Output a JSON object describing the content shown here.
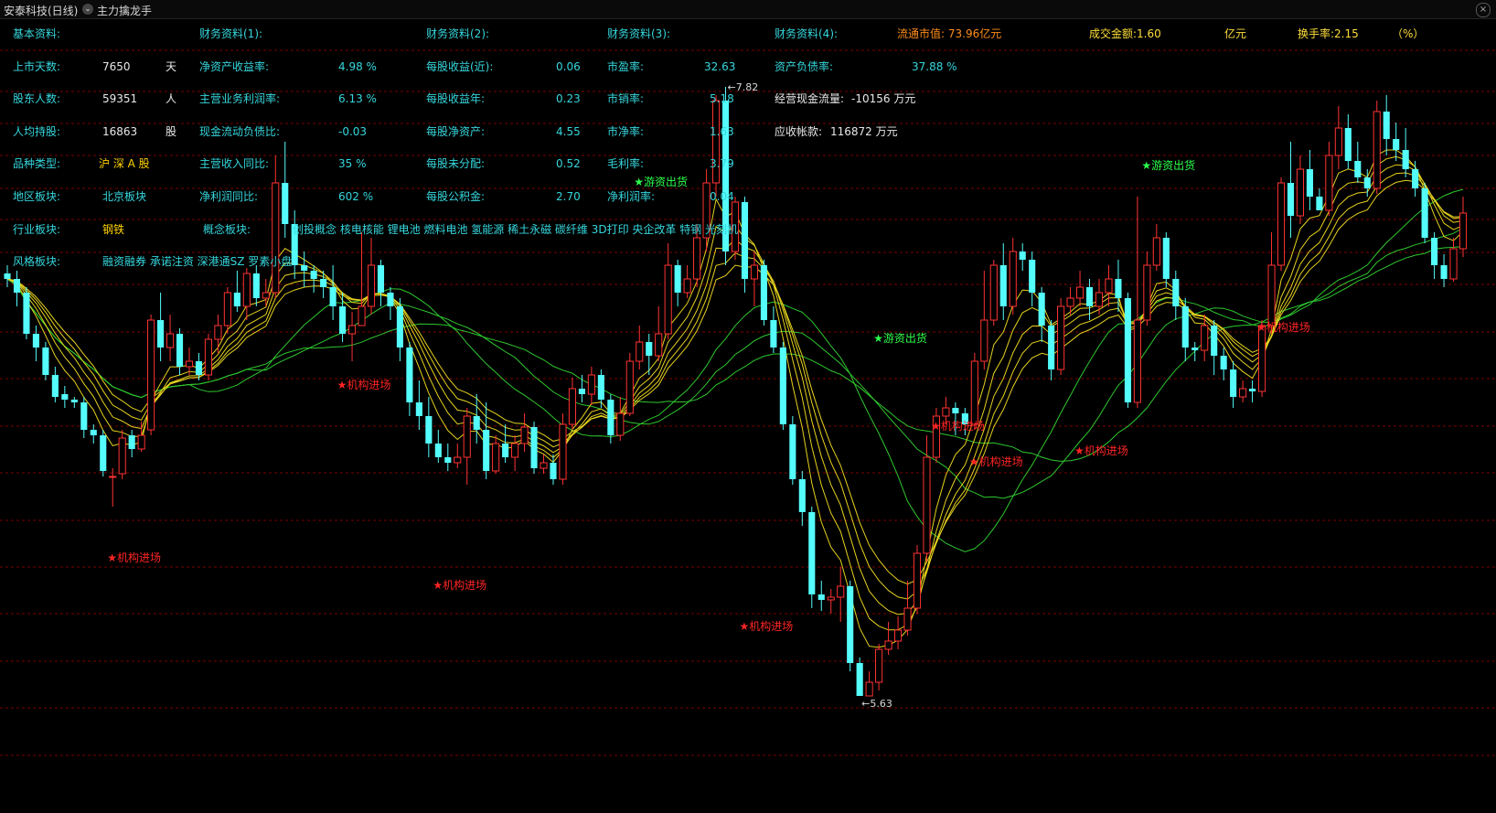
{
  "window": {
    "title": "安泰科技(日线)",
    "indicator_name": "主力擒龙手",
    "close_symbol": "×"
  },
  "info_panel": {
    "col1": {
      "header": "基本资料:",
      "rows": [
        {
          "label": "上市天数:",
          "value": "7650",
          "unit": "天"
        },
        {
          "label": "股东人数:",
          "value": "59351",
          "unit": "人"
        },
        {
          "label": "人均持股:",
          "value": "16863",
          "unit": "股"
        },
        {
          "label": "品种类型:",
          "value": "沪 深 A 股",
          "unit": ""
        },
        {
          "label": "地区板块:",
          "value": "北京板块",
          "unit": ""
        },
        {
          "label": "行业板块:",
          "value": "钢铁",
          "unit": ""
        },
        {
          "label": "风格板块:",
          "value": "融资融券 承诺注资 深港通SZ 罗素小盘",
          "unit": ""
        }
      ]
    },
    "col2": {
      "header": "财务资料(1):",
      "rows": [
        {
          "label": "净资产收益率:",
          "value": "4.98 %"
        },
        {
          "label": "主营业务利润率:",
          "value": "6.13 %"
        },
        {
          "label": "现金流动负债比:",
          "value": "-0.03"
        },
        {
          "label": "主营收入同比:",
          "value": "35 %"
        },
        {
          "label": "净利润同比:",
          "value": "602 %"
        }
      ],
      "concept_label": "概念板块:",
      "concept_value": "创投概念 核电核能 锂电池 燃料电池 氢能源 稀土永磁 碳纤维 3D打印 央企改革 特钢 光刻机"
    },
    "col3": {
      "header": "财务资料(2):",
      "rows": [
        {
          "label": "每股收益(近):",
          "value": "0.06"
        },
        {
          "label": "每股收益年:",
          "value": "0.23"
        },
        {
          "label": "每股净资产:",
          "value": "4.55"
        },
        {
          "label": "每股未分配:",
          "value": "0.52"
        },
        {
          "label": "每股公积金:",
          "value": "2.70"
        }
      ]
    },
    "col4": {
      "header": "财务资料(3):",
      "rows": [
        {
          "label": "市盈率:",
          "value": "32.63"
        },
        {
          "label": "市销率:",
          "value": "5.18"
        },
        {
          "label": "市净率:",
          "value": "1.63"
        },
        {
          "label": "毛利率:",
          "value": "3.79"
        },
        {
          "label": "净利润率:",
          "value": "0.04"
        }
      ]
    },
    "col5": {
      "header": "财务资料(4):",
      "rows": [
        {
          "label": "资产负债率:",
          "value": "37.88 %"
        },
        {
          "label": "经营现金流量:",
          "value": "-10156 万元"
        },
        {
          "label": "应收帐款:",
          "value": "116872 万元"
        }
      ]
    },
    "market": {
      "float_cap": "流通市值: 73.96亿元",
      "turnover_amount": "成交金额:1.60",
      "turnover_unit": "亿元",
      "turnover_rate": "换手率:2.15",
      "turnover_rate_unit": "（%）"
    }
  },
  "chart_data": {
    "type": "candlestick",
    "y_range": [
      5.3,
      8.05
    ],
    "high_label": "7.82",
    "low_label": "5.63",
    "colors": {
      "up": "#ff3232",
      "down": "#54fcfc",
      "ma_yellow": "#e6d21e",
      "ma_green": "#2ec82e",
      "grid": "#7a0000"
    },
    "candles": [
      [
        7.17,
        7.15,
        7.2,
        7.12
      ],
      [
        7.15,
        7.1,
        7.18,
        7.05
      ],
      [
        7.1,
        6.95,
        7.12,
        6.93
      ],
      [
        6.95,
        6.9,
        6.98,
        6.85
      ],
      [
        6.9,
        6.8,
        6.92,
        6.78
      ],
      [
        6.8,
        6.72,
        6.83,
        6.7
      ],
      [
        6.73,
        6.71,
        6.76,
        6.68
      ],
      [
        6.71,
        6.7,
        6.72,
        6.68
      ],
      [
        6.7,
        6.6,
        6.72,
        6.57
      ],
      [
        6.6,
        6.58,
        6.62,
        6.55
      ],
      [
        6.58,
        6.45,
        6.6,
        6.43
      ],
      [
        6.43,
        6.43,
        6.46,
        6.32
      ],
      [
        6.44,
        6.57,
        6.6,
        6.42
      ],
      [
        6.58,
        6.53,
        6.6,
        6.5
      ],
      [
        6.53,
        6.58,
        6.63,
        6.52
      ],
      [
        6.6,
        7.0,
        7.02,
        6.58
      ],
      [
        7.0,
        6.9,
        7.1,
        6.85
      ],
      [
        6.9,
        6.95,
        7.02,
        6.85
      ],
      [
        6.95,
        6.83,
        6.97,
        6.8
      ],
      [
        6.83,
        6.85,
        6.9,
        6.8
      ],
      [
        6.85,
        6.8,
        6.88,
        6.78
      ],
      [
        6.8,
        6.93,
        6.95,
        6.78
      ],
      [
        6.93,
        6.98,
        7.02,
        6.88
      ],
      [
        6.98,
        7.1,
        7.12,
        6.95
      ],
      [
        7.1,
        7.05,
        7.18,
        7.03
      ],
      [
        7.05,
        7.17,
        7.19,
        7.0
      ],
      [
        7.17,
        7.08,
        7.2,
        7.05
      ],
      [
        7.08,
        7.1,
        7.15,
        7.05
      ],
      [
        7.1,
        7.5,
        7.6,
        7.08
      ],
      [
        7.5,
        7.35,
        7.65,
        7.3
      ],
      [
        7.35,
        7.2,
        7.4,
        7.15
      ],
      [
        7.2,
        7.18,
        7.25,
        7.12
      ],
      [
        7.18,
        7.15,
        7.2,
        7.1
      ],
      [
        7.15,
        7.12,
        7.18,
        7.08
      ],
      [
        7.12,
        7.05,
        7.2,
        7.0
      ],
      [
        7.05,
        6.95,
        7.1,
        6.92
      ],
      [
        6.95,
        6.98,
        7.03,
        6.85
      ],
      [
        6.98,
        7.05,
        7.32,
        6.98
      ],
      [
        7.05,
        7.2,
        7.3,
        7.02
      ],
      [
        7.2,
        7.1,
        7.22,
        7.05
      ],
      [
        7.1,
        7.05,
        7.12,
        7.0
      ],
      [
        7.05,
        6.9,
        7.08,
        6.85
      ],
      [
        6.9,
        6.7,
        6.92,
        6.65
      ],
      [
        6.7,
        6.65,
        6.78,
        6.6
      ],
      [
        6.65,
        6.55,
        6.72,
        6.5
      ],
      [
        6.55,
        6.5,
        6.6,
        6.48
      ],
      [
        6.5,
        6.48,
        6.55,
        6.45
      ],
      [
        6.48,
        6.5,
        6.55,
        6.46
      ],
      [
        6.5,
        6.65,
        6.68,
        6.4
      ],
      [
        6.65,
        6.6,
        6.73,
        6.55
      ],
      [
        6.6,
        6.45,
        6.7,
        6.42
      ],
      [
        6.45,
        6.55,
        6.58,
        6.44
      ],
      [
        6.55,
        6.5,
        6.62,
        6.48
      ],
      [
        6.5,
        6.55,
        6.58,
        6.45
      ],
      [
        6.55,
        6.61,
        6.66,
        6.52
      ],
      [
        6.61,
        6.46,
        6.63,
        6.44
      ],
      [
        6.46,
        6.48,
        6.51,
        6.44
      ],
      [
        6.48,
        6.42,
        6.51,
        6.4
      ],
      [
        6.42,
        6.62,
        6.66,
        6.4
      ],
      [
        6.62,
        6.75,
        6.79,
        6.6
      ],
      [
        6.75,
        6.73,
        6.8,
        6.7
      ],
      [
        6.73,
        6.8,
        6.83,
        6.69
      ],
      [
        6.8,
        6.71,
        6.82,
        6.68
      ],
      [
        6.71,
        6.58,
        6.73,
        6.55
      ],
      [
        6.58,
        6.66,
        6.72,
        6.56
      ],
      [
        6.66,
        6.85,
        6.88,
        6.65
      ],
      [
        6.85,
        6.92,
        6.98,
        6.82
      ],
      [
        6.92,
        6.87,
        6.95,
        6.8
      ],
      [
        6.87,
        6.95,
        7.05,
        6.85
      ],
      [
        6.95,
        7.2,
        7.28,
        6.93
      ],
      [
        7.2,
        7.1,
        7.22,
        7.05
      ],
      [
        7.1,
        7.15,
        7.2,
        7.08
      ],
      [
        7.15,
        7.3,
        7.35,
        7.12
      ],
      [
        7.3,
        7.5,
        7.55,
        7.25
      ],
      [
        7.5,
        7.8,
        7.82,
        7.45
      ],
      [
        7.8,
        7.25,
        7.85,
        7.2
      ],
      [
        7.25,
        7.43,
        7.45,
        7.22
      ],
      [
        7.43,
        7.15,
        7.45,
        7.1
      ],
      [
        7.15,
        7.2,
        7.25,
        7.05
      ],
      [
        7.2,
        7.0,
        7.22,
        6.98
      ],
      [
        7.0,
        6.9,
        7.05,
        6.88
      ],
      [
        6.9,
        6.62,
        6.92,
        6.6
      ],
      [
        6.62,
        6.42,
        6.65,
        6.4
      ],
      [
        6.42,
        6.3,
        6.45,
        6.25
      ],
      [
        6.3,
        6.0,
        6.32,
        5.95
      ],
      [
        6.0,
        5.98,
        6.05,
        5.94
      ],
      [
        5.98,
        5.99,
        6.02,
        5.93
      ],
      [
        5.99,
        6.03,
        6.1,
        5.9
      ],
      [
        6.03,
        5.75,
        6.05,
        5.72
      ],
      [
        5.75,
        5.63,
        5.77,
        5.63
      ],
      [
        5.63,
        5.68,
        5.72,
        5.63
      ],
      [
        5.68,
        5.8,
        5.82,
        5.65
      ],
      [
        5.8,
        5.83,
        5.9,
        5.78
      ],
      [
        5.83,
        5.87,
        5.92,
        5.8
      ],
      [
        5.87,
        5.95,
        6.05,
        5.85
      ],
      [
        5.95,
        6.15,
        6.18,
        5.93
      ],
      [
        6.15,
        6.5,
        6.58,
        6.12
      ],
      [
        6.5,
        6.65,
        6.68,
        6.48
      ],
      [
        6.65,
        6.68,
        6.72,
        6.62
      ],
      [
        6.68,
        6.66,
        6.7,
        6.58
      ],
      [
        6.66,
        6.62,
        6.68,
        6.58
      ],
      [
        6.62,
        6.85,
        6.88,
        6.6
      ],
      [
        6.85,
        7.0,
        7.18,
        6.82
      ],
      [
        7.0,
        7.2,
        7.22,
        6.98
      ],
      [
        7.2,
        7.05,
        7.28,
        7.0
      ],
      [
        7.05,
        7.25,
        7.3,
        7.02
      ],
      [
        7.25,
        7.22,
        7.28,
        7.18
      ],
      [
        7.22,
        7.1,
        7.25,
        7.05
      ],
      [
        7.1,
        6.98,
        7.12,
        6.92
      ],
      [
        6.98,
        6.82,
        7.0,
        6.78
      ],
      [
        6.82,
        7.05,
        7.08,
        6.8
      ],
      [
        7.05,
        7.08,
        7.12,
        7.02
      ],
      [
        7.08,
        7.12,
        7.18,
        7.05
      ],
      [
        7.12,
        7.05,
        7.15,
        7.0
      ],
      [
        7.05,
        7.1,
        7.15,
        7.02
      ],
      [
        7.1,
        7.15,
        7.2,
        7.05
      ],
      [
        7.15,
        7.08,
        7.22,
        7.03
      ],
      [
        7.08,
        6.7,
        7.1,
        6.68
      ],
      [
        6.7,
        7.0,
        7.45,
        6.68
      ],
      [
        7.0,
        7.2,
        7.25,
        6.98
      ],
      [
        7.2,
        7.3,
        7.35,
        7.18
      ],
      [
        7.3,
        7.15,
        7.32,
        7.12
      ],
      [
        7.15,
        7.05,
        7.18,
        7.0
      ],
      [
        7.05,
        6.9,
        7.08,
        6.85
      ],
      [
        6.9,
        6.89,
        6.92,
        6.85
      ],
      [
        6.89,
        6.98,
        7.02,
        6.85
      ],
      [
        6.98,
        6.87,
        7.0,
        6.8
      ],
      [
        6.87,
        6.82,
        6.9,
        6.78
      ],
      [
        6.82,
        6.72,
        6.85,
        6.68
      ],
      [
        6.72,
        6.75,
        6.78,
        6.7
      ],
      [
        6.75,
        6.74,
        6.78,
        6.7
      ],
      [
        6.74,
        6.98,
        7.0,
        6.72
      ],
      [
        6.98,
        7.2,
        7.32,
        6.95
      ],
      [
        7.2,
        7.5,
        7.52,
        7.18
      ],
      [
        7.5,
        7.38,
        7.65,
        7.3
      ],
      [
        7.38,
        7.55,
        7.6,
        7.35
      ],
      [
        7.55,
        7.45,
        7.62,
        7.4
      ],
      [
        7.45,
        7.4,
        7.48,
        7.4
      ],
      [
        7.4,
        7.6,
        7.65,
        7.38
      ],
      [
        7.6,
        7.7,
        7.78,
        7.55
      ],
      [
        7.7,
        7.58,
        7.75,
        7.55
      ],
      [
        7.58,
        7.52,
        7.65,
        7.5
      ],
      [
        7.52,
        7.48,
        7.55,
        7.45
      ],
      [
        7.48,
        7.76,
        7.8,
        7.46
      ],
      [
        7.76,
        7.66,
        7.82,
        7.6
      ],
      [
        7.66,
        7.62,
        7.72,
        7.58
      ],
      [
        7.62,
        7.55,
        7.7,
        7.52
      ],
      [
        7.55,
        7.48,
        7.58,
        7.45
      ],
      [
        7.48,
        7.3,
        7.5,
        7.28
      ],
      [
        7.3,
        7.2,
        7.32,
        7.15
      ],
      [
        7.2,
        7.15,
        7.24,
        7.12
      ],
      [
        7.15,
        7.26,
        7.3,
        7.14
      ],
      [
        7.26,
        7.39,
        7.45,
        7.23
      ]
    ],
    "signals": [
      {
        "text": "★机构进场",
        "type": "buy",
        "bar": 11,
        "price": 6.12
      },
      {
        "text": "★机构进场",
        "type": "buy",
        "bar": 35,
        "price": 6.75
      },
      {
        "text": "★机构进场",
        "type": "buy",
        "bar": 45,
        "price": 6.02
      },
      {
        "text": "★游资出货",
        "type": "sell",
        "bar": 66,
        "price": 7.49
      },
      {
        "text": "★机构进场",
        "type": "buy",
        "bar": 77,
        "price": 5.87
      },
      {
        "text": "★游资出货",
        "type": "sell",
        "bar": 91,
        "price": 6.92
      },
      {
        "text": "★机构进场",
        "type": "buy",
        "bar": 97,
        "price": 6.6
      },
      {
        "text": "★机构进场",
        "type": "buy",
        "bar": 101,
        "price": 6.47
      },
      {
        "text": "★机构进场",
        "type": "buy",
        "bar": 112,
        "price": 6.51
      },
      {
        "text": "★游资出货",
        "type": "sell",
        "bar": 119,
        "price": 7.55
      },
      {
        "text": "★机构进场",
        "type": "buy",
        "bar": 131,
        "price": 6.96
      }
    ]
  }
}
